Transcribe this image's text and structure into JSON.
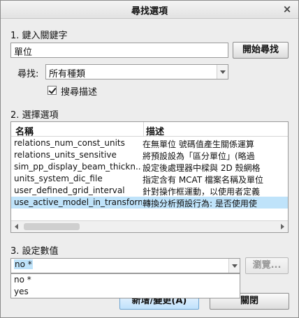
{
  "dialog": {
    "title": "尋找選項",
    "close_symbol": "×"
  },
  "step1": {
    "label": "1.  鍵入關鍵字",
    "keyword_value": "單位",
    "search_button": "開始尋找",
    "find_label": "尋找:",
    "find_selected": "所有種類",
    "search_desc_label": "搜尋描述",
    "search_desc_checked": true
  },
  "step2": {
    "label": "2.  選擇選項",
    "columns": {
      "name": "名稱",
      "description": "描述"
    },
    "rows": [
      {
        "name": "relations_num_const_units",
        "description": "在無單位 號碼值產生關係運算",
        "selected": false
      },
      {
        "name": "relations_units_sensitive",
        "description": "將預設設為「區分單位」(略過",
        "selected": false
      },
      {
        "name": "sim_pp_display_beam_thickn...",
        "description": "設定後處理器中樑與 2D 殼網格",
        "selected": false
      },
      {
        "name": "units_system_dic_file",
        "description": "指定含有 MCAT 檔案名稱及單位",
        "selected": false
      },
      {
        "name": "user_defined_grid_interval",
        "description": "針對操作框運動，以使用者定義",
        "selected": false
      },
      {
        "name": "use_active_model_in_transform",
        "description": "轉換分析預設行為: 是否使用使",
        "selected": true
      }
    ]
  },
  "step3": {
    "label": "3.   設定數值",
    "value": "no *",
    "browse_button": "瀏覽...",
    "options": [
      "no *",
      "yes"
    ]
  },
  "footer": {
    "add_change_button": "新增/變更(A)",
    "close_button": "關閉"
  },
  "colors": {
    "selection": "#bfe3fa",
    "primary_button": "#bfe1fb"
  }
}
